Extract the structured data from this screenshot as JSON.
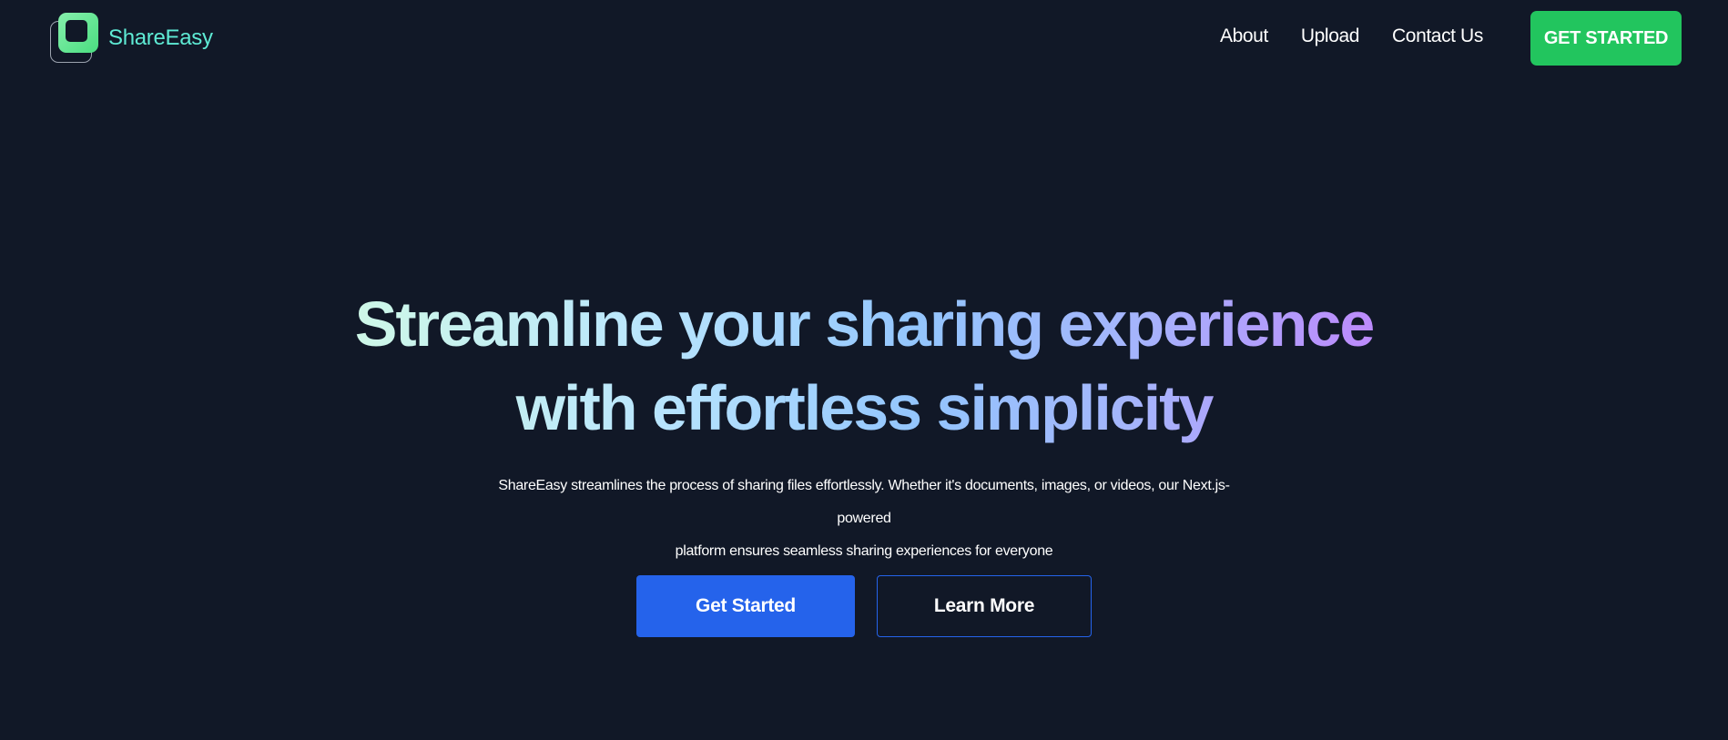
{
  "colors": {
    "background": "#111827",
    "accent_green": "#22c55e",
    "accent_blue": "#2563eb",
    "logo_text": "#5eead4"
  },
  "header": {
    "logo_icon": "overlapping-squares-logo-icon",
    "logo_text": "ShareEasy",
    "nav": [
      {
        "label": "About"
      },
      {
        "label": "Upload"
      },
      {
        "label": "Contact Us"
      }
    ],
    "cta_label": "GET STARTED"
  },
  "hero": {
    "headline_line1": "Streamline your sharing experience",
    "headline_line2": "with effortless simplicity",
    "subtitle_line1": "ShareEasy streamlines the process of sharing files effortlessly. Whether it's documents, images, or videos, our Next.js-powered",
    "subtitle_line2": "platform ensures seamless sharing experiences for everyone",
    "primary_button": "Get Started",
    "secondary_button": "Learn More"
  }
}
